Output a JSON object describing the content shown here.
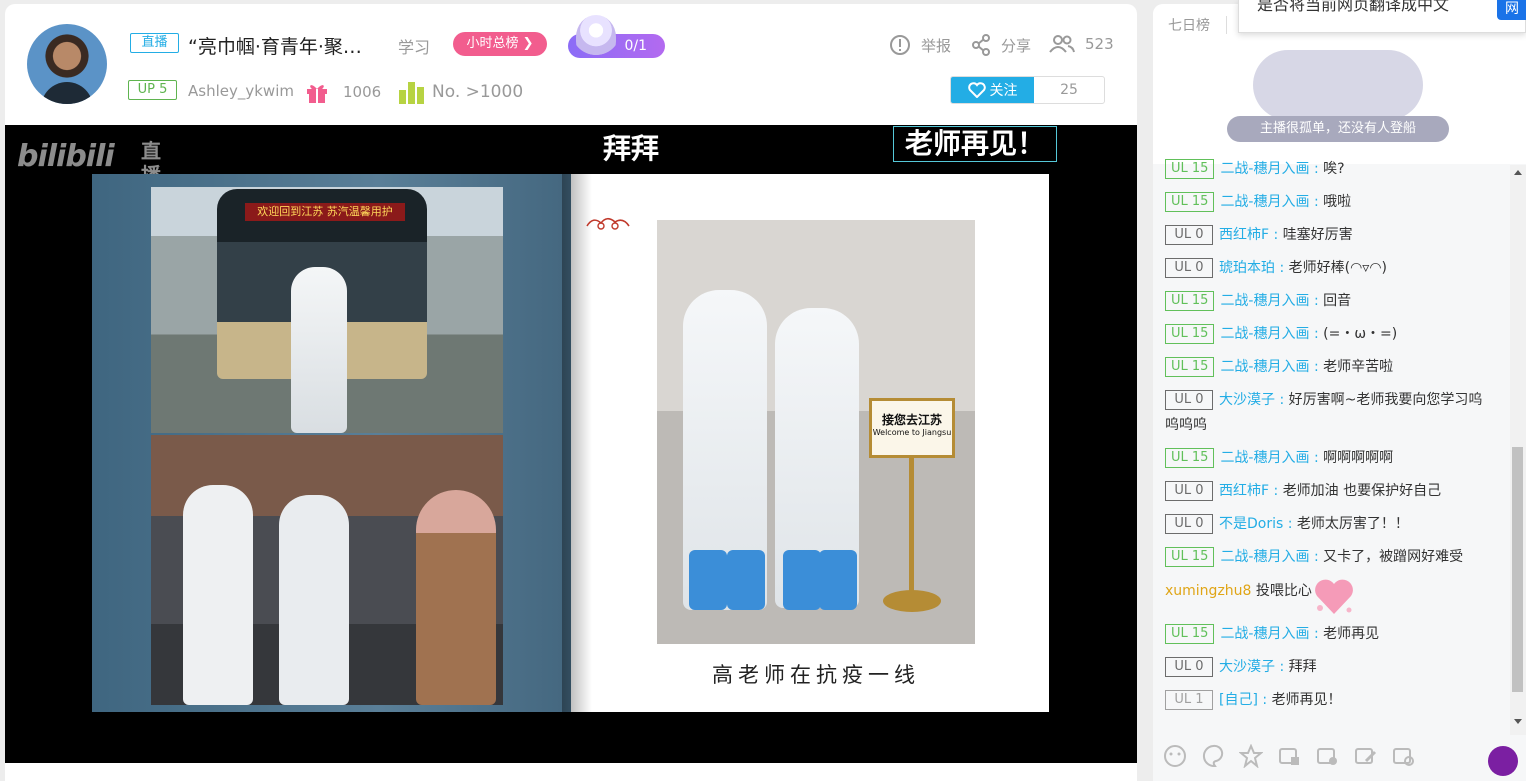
{
  "header": {
    "live_tag": "直播",
    "title": "“亮巾帼·育青年·聚…",
    "area": "学习",
    "rank_button": "小时总榜",
    "pk_progress": "0/1",
    "report": "举报",
    "share": "分享",
    "viewers": "523",
    "up_tag": "UP 5",
    "uname": "Ashley_ykwim",
    "gift_count": "1006",
    "rank_no": "No. >1000",
    "follow_label": "关注",
    "follow_count": "25"
  },
  "player": {
    "watermark_main": "bilibili",
    "watermark_sub": "直播",
    "subtitle_center": "拜拜",
    "subtitle_right": "老师再见！",
    "bus_banner": "欢迎回到江苏 苏汽温馨用护",
    "sign_text": "接您去江苏",
    "sign_sub": "Welcome to Jiangsu",
    "caption": "高老师在抗疫一线"
  },
  "chat": {
    "tab": "七日榜",
    "empty_text": "主播很孤单，还没有人登船",
    "translate_prompt": "是否将当前网页翻译成中文",
    "translate_btn": "网",
    "messages": [
      {
        "badge": "UL 15",
        "level": "ul15",
        "nick": "二战-穗月入画",
        "text": "唉?"
      },
      {
        "badge": "UL 15",
        "level": "ul15",
        "nick": "二战-穗月入画",
        "text": "哦啦"
      },
      {
        "badge": "UL 0",
        "level": "ul0",
        "nick": "西红柿F",
        "text": "哇塞好厉害"
      },
      {
        "badge": "UL 0",
        "level": "ul0",
        "nick": "琥珀本珀",
        "text": "老师好棒(◠▿◠)"
      },
      {
        "badge": "UL 15",
        "level": "ul15",
        "nick": "二战-穗月入画",
        "text": "回音"
      },
      {
        "badge": "UL 15",
        "level": "ul15",
        "nick": "二战-穗月入画",
        "text": "(=・ω・=)"
      },
      {
        "badge": "UL 15",
        "level": "ul15",
        "nick": "二战-穗月入画",
        "text": "老师辛苦啦"
      },
      {
        "badge": "UL 0",
        "level": "ul0",
        "nick": "大沙漠子",
        "text": "好厉害啊~老师我要向您学习呜呜呜呜"
      },
      {
        "badge": "UL 15",
        "level": "ul15",
        "nick": "二战-穗月入画",
        "text": "啊啊啊啊啊"
      },
      {
        "badge": "UL 0",
        "level": "ul0",
        "nick": "西红柿F",
        "text": "老师加油 也要保护好自己"
      },
      {
        "badge": "UL 0",
        "level": "ul0",
        "nick": "不是Doris",
        "text": "老师太厉害了！！"
      },
      {
        "badge": "UL 15",
        "level": "ul15",
        "nick": "二战-穗月入画",
        "text": "又卡了，被蹭网好难受"
      }
    ],
    "gift_msg": {
      "nick": "xumingzhu8",
      "text": "投喂比心"
    },
    "messages2": [
      {
        "badge": "UL 15",
        "level": "ul15",
        "nick": "二战-穗月入画",
        "text": "老师再见"
      },
      {
        "badge": "UL 0",
        "level": "ul0",
        "nick": "大沙漠子",
        "text": "拜拜"
      },
      {
        "badge": "UL 1",
        "level": "ul1",
        "nick": "[自己]",
        "text": "老师再见！"
      }
    ]
  }
}
